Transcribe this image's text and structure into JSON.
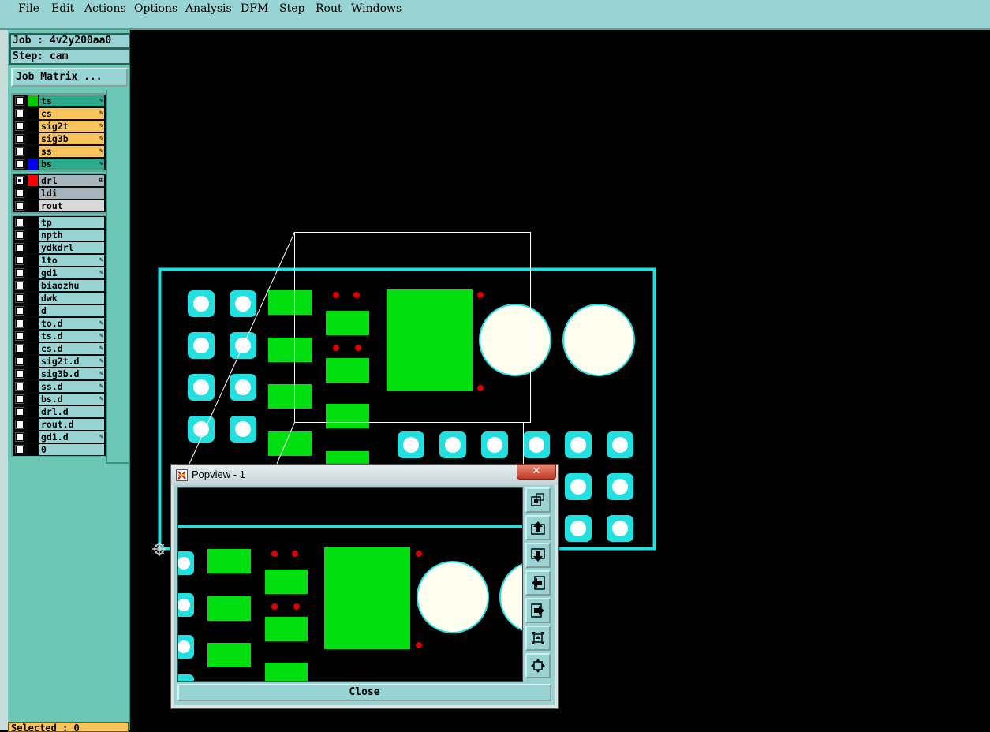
{
  "menu": [
    "File",
    "Edit",
    "Actions",
    "Options",
    "Analysis",
    "DFM",
    "Step",
    "Rout",
    "Windows"
  ],
  "job_label": "Job : 4v2y200aa0",
  "step_label": "Step: cam",
  "job_matrix_label": "Job Matrix ...",
  "layer_groups": [
    [
      {
        "name": "ts",
        "color": "#2aab8c",
        "swatch": "#00cc00",
        "edit": true,
        "active": false
      },
      {
        "name": "cs",
        "color": "#f7c35a",
        "swatch": "#000",
        "edit": true,
        "active": false
      },
      {
        "name": "sig2t",
        "color": "#f7c35a",
        "swatch": "#000",
        "edit": true,
        "active": false
      },
      {
        "name": "sig3b",
        "color": "#f7c35a",
        "swatch": "#000",
        "edit": true,
        "active": false
      },
      {
        "name": "ss",
        "color": "#f7c35a",
        "swatch": "#000",
        "edit": true,
        "active": false
      },
      {
        "name": "bs",
        "color": "#2aab8c",
        "swatch": "#0000ff",
        "edit": true,
        "active": false
      }
    ],
    [
      {
        "name": "drl",
        "color": "#a8b4bc",
        "swatch": "#ff0000",
        "edit": false,
        "active": true,
        "mark": "⊞"
      },
      {
        "name": "ldi",
        "color": "#a8b4bc",
        "swatch": "#000",
        "edit": false,
        "active": false
      },
      {
        "name": "rout",
        "color": "#d8d8d8",
        "swatch": "#000",
        "edit": false,
        "active": false
      }
    ],
    [
      {
        "name": "tp",
        "color": "#99d4d4",
        "swatch": "#000",
        "edit": false,
        "active": false
      },
      {
        "name": "npth",
        "color": "#99d4d4",
        "swatch": "#000",
        "edit": false,
        "active": false
      },
      {
        "name": "ydkdrl",
        "color": "#99d4d4",
        "swatch": "#000",
        "edit": false,
        "active": false
      },
      {
        "name": "1to",
        "color": "#99d4d4",
        "swatch": "#000",
        "edit": true,
        "active": false
      },
      {
        "name": "gd1",
        "color": "#99d4d4",
        "swatch": "#000",
        "edit": true,
        "active": false
      },
      {
        "name": "biaozhu",
        "color": "#99d4d4",
        "swatch": "#000",
        "edit": false,
        "active": false
      },
      {
        "name": "dwk",
        "color": "#99d4d4",
        "swatch": "#000",
        "edit": false,
        "active": false
      },
      {
        "name": "d",
        "color": "#99d4d4",
        "swatch": "#000",
        "edit": false,
        "active": false
      },
      {
        "name": "to.d",
        "color": "#99d4d4",
        "swatch": "#000",
        "edit": true,
        "active": false
      },
      {
        "name": "ts.d",
        "color": "#99d4d4",
        "swatch": "#000",
        "edit": true,
        "active": false
      },
      {
        "name": "cs.d",
        "color": "#99d4d4",
        "swatch": "#000",
        "edit": true,
        "active": false
      },
      {
        "name": "sig2t.d",
        "color": "#99d4d4",
        "swatch": "#000",
        "edit": true,
        "active": false
      },
      {
        "name": "sig3b.d",
        "color": "#99d4d4",
        "swatch": "#000",
        "edit": true,
        "active": false
      },
      {
        "name": "ss.d",
        "color": "#99d4d4",
        "swatch": "#000",
        "edit": true,
        "active": false
      },
      {
        "name": "bs.d",
        "color": "#99d4d4",
        "swatch": "#000",
        "edit": true,
        "active": false
      },
      {
        "name": "drl.d",
        "color": "#99d4d4",
        "swatch": "#000",
        "edit": false,
        "active": false
      },
      {
        "name": "rout.d",
        "color": "#99d4d4",
        "swatch": "#000",
        "edit": false,
        "active": false
      },
      {
        "name": "gd1.d",
        "color": "#99d4d4",
        "swatch": "#000",
        "edit": true,
        "active": false
      },
      {
        "name": "0",
        "color": "#99d4d4",
        "swatch": "#000",
        "edit": false,
        "active": false
      }
    ]
  ],
  "selected_label": "Selected : 0",
  "popview": {
    "title": "Popview - 1",
    "close_x": "✕",
    "close_label": "Close",
    "tool_buttons": [
      "zoom-window",
      "pan-up",
      "pan-down",
      "pan-left",
      "pan-right",
      "zoom-out",
      "zoom-home"
    ]
  },
  "colors": {
    "board_outline": "#22e0e0",
    "pad_green": "#00e010",
    "pad_cyan": "#22e0e0",
    "drill_red": "#e00000",
    "hole_white": "#fffff0"
  }
}
